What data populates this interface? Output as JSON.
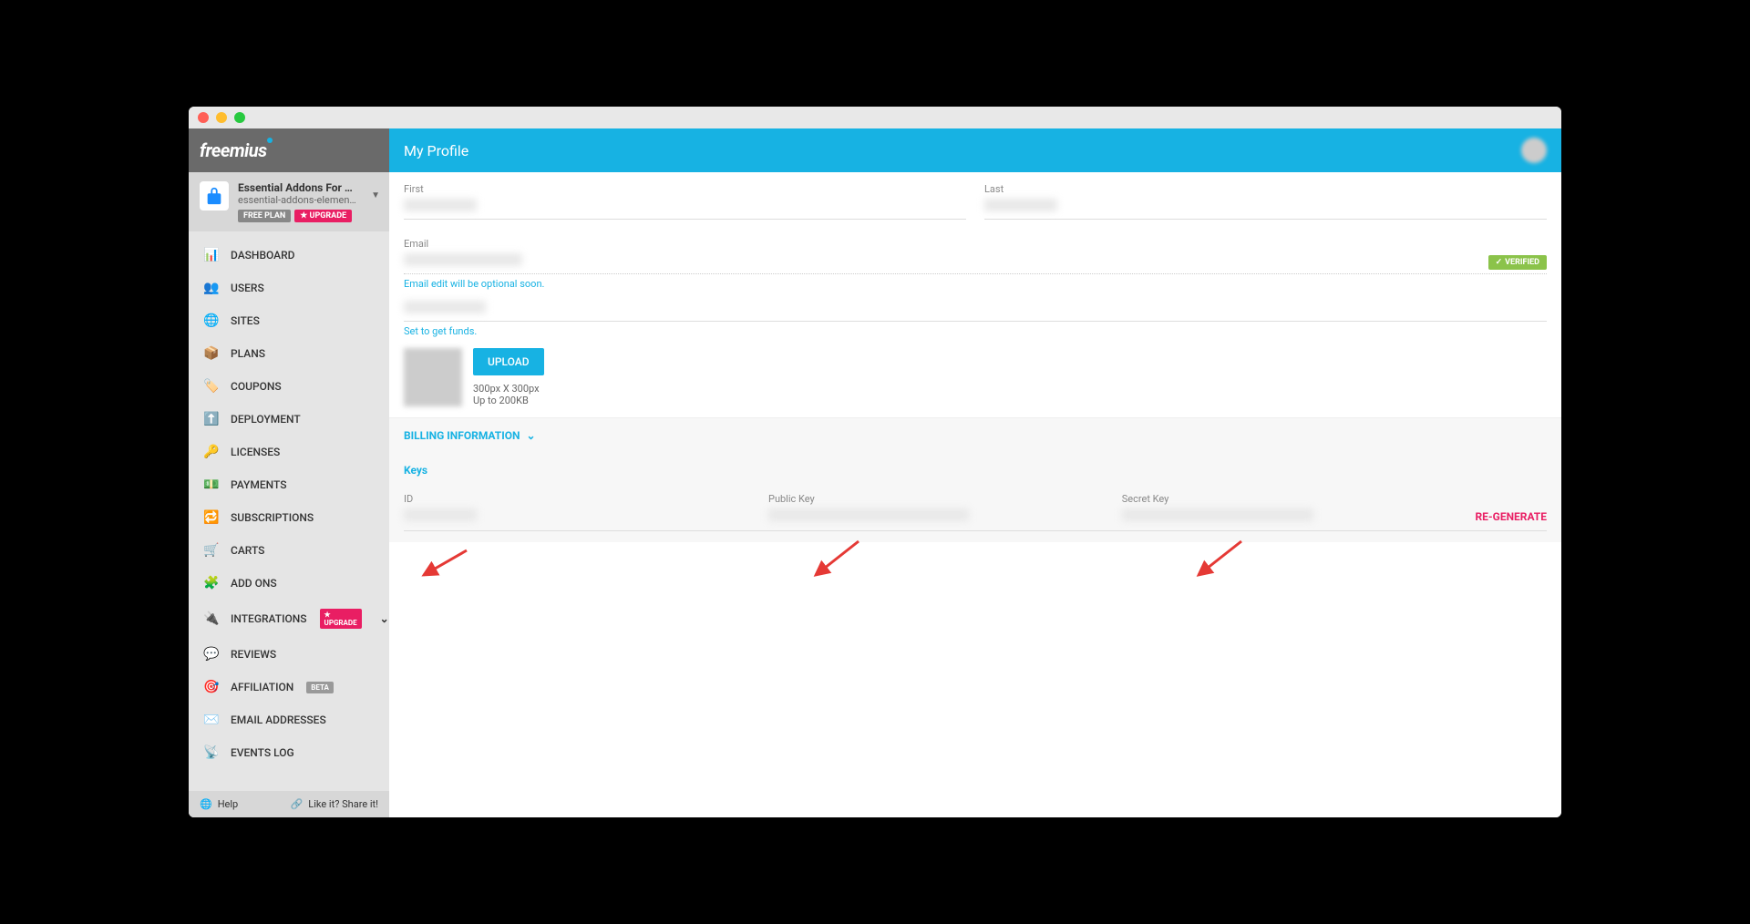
{
  "header": {
    "title": "My Profile",
    "logo": "freemius"
  },
  "product": {
    "name": "Essential Addons For …",
    "slug": "essential-addons-elemen…",
    "plan_badge": "FREE PLAN",
    "upgrade_badge": "UPGRADE"
  },
  "nav": {
    "items": [
      {
        "icon": "bar-chart",
        "label": "DASHBOARD"
      },
      {
        "icon": "users",
        "label": "USERS"
      },
      {
        "icon": "globe",
        "label": "SITES"
      },
      {
        "icon": "dropbox",
        "label": "PLANS"
      },
      {
        "icon": "tag",
        "label": "COUPONS"
      },
      {
        "icon": "upload",
        "label": "DEPLOYMENT"
      },
      {
        "icon": "key",
        "label": "LICENSES"
      },
      {
        "icon": "money",
        "label": "PAYMENTS"
      },
      {
        "icon": "refresh",
        "label": "SUBSCRIPTIONS"
      },
      {
        "icon": "cart",
        "label": "CARTS"
      },
      {
        "icon": "puzzle",
        "label": "ADD ONS"
      },
      {
        "icon": "plug",
        "label": "INTEGRATIONS",
        "upgrade": "UPGRADE",
        "expandable": true
      },
      {
        "icon": "comment",
        "label": "REVIEWS"
      },
      {
        "icon": "target",
        "label": "AFFILIATION",
        "beta": "BETA"
      },
      {
        "icon": "mail",
        "label": "EMAIL ADDRESSES"
      },
      {
        "icon": "log",
        "label": "EVENTS LOG"
      }
    ]
  },
  "footer": {
    "help": "Help",
    "share": "Like it? Share it!"
  },
  "profile": {
    "first_label": "First",
    "last_label": "Last",
    "email_label": "Email",
    "email_hint": "Email edit will be optional soon.",
    "verified_label": "VERIFIED",
    "funds_hint": "Set to get funds.",
    "upload_label": "UPLOAD",
    "upload_dims": "300px X 300px",
    "upload_size": "Up to 200KB"
  },
  "billing": {
    "header": "BILLING INFORMATION"
  },
  "keys": {
    "title": "Keys",
    "id_label": "ID",
    "public_label": "Public Key",
    "secret_label": "Secret Key",
    "regenerate": "RE-GENERATE"
  }
}
